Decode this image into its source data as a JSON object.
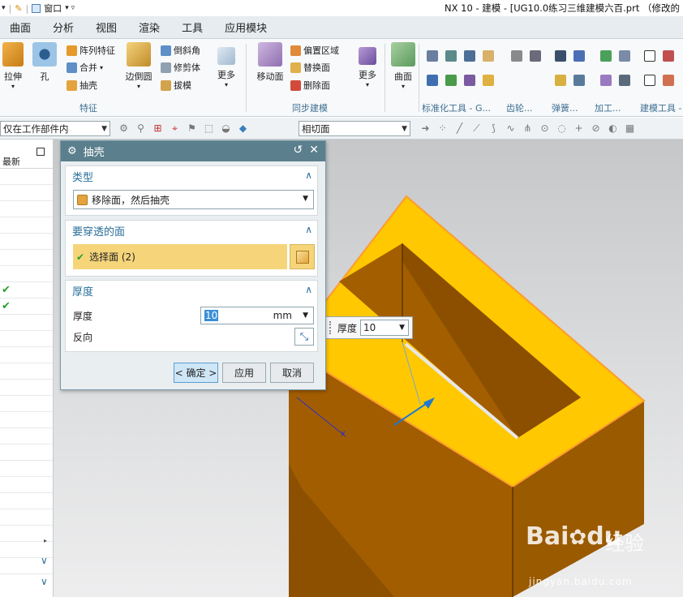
{
  "window": {
    "quick_access_window": "窗口",
    "title": "NX 10 - 建模 - [UG10.0练习三维建模六百.prt （修改的"
  },
  "menubar": {
    "items": [
      "曲面",
      "分析",
      "视图",
      "渲染",
      "工具",
      "应用模块"
    ]
  },
  "ribbon": {
    "extrude": "拉伸",
    "hole": "孔",
    "pattern_feature": "阵列特征",
    "unite": "合并",
    "shell": "抽壳",
    "edge_blend": "边倒圆",
    "chamfer": "倒斜角",
    "trim_body": "修剪体",
    "draft": "拔模",
    "more1": "更多",
    "group_feature": "特征",
    "move_face": "移动面",
    "offset_region": "偏置区域",
    "replace_face": "替换面",
    "delete_face": "删除面",
    "more2": "更多",
    "group_sync": "同步建模",
    "surface": "曲面",
    "group_std_tools": "标准化工具 - G...",
    "group_gear": "齿轮...",
    "group_spring": "弹簧...",
    "group_machining": "加工...",
    "group_build_tools": "建模工具 -"
  },
  "toolbar2": {
    "filter_scope": "仅在工作部件内",
    "snap_mode": "相切面"
  },
  "navigator": {
    "header": "最新",
    "rows": 25,
    "check_rows": [
      7,
      8
    ]
  },
  "dialog": {
    "title": "抽壳",
    "type_section": "类型",
    "type_value": "移除面，然后抽壳",
    "pierce_section": "要穿透的面",
    "select_face": "选择面 (2)",
    "thickness_section": "厚度",
    "thickness_label": "厚度",
    "thickness_value": "10",
    "unit": "mm",
    "reverse_label": "反向",
    "ok_button": "< 确定 >",
    "apply_button": "应用",
    "cancel_button": "取消"
  },
  "float_input": {
    "label": "厚度",
    "value": "10"
  },
  "watermark": {
    "brand": "Bai",
    "brand2": "du",
    "cn": "经验",
    "url": "jingyan.baidu.com"
  },
  "colors": {
    "dialog_title": "#5b7f8c",
    "section_head": "#2a6f9a",
    "selected_face": "#f6d57a",
    "model_top": "#ffc800",
    "model_side": "#a35e00",
    "model_front": "#8c5000",
    "check": "#2aa02a"
  }
}
